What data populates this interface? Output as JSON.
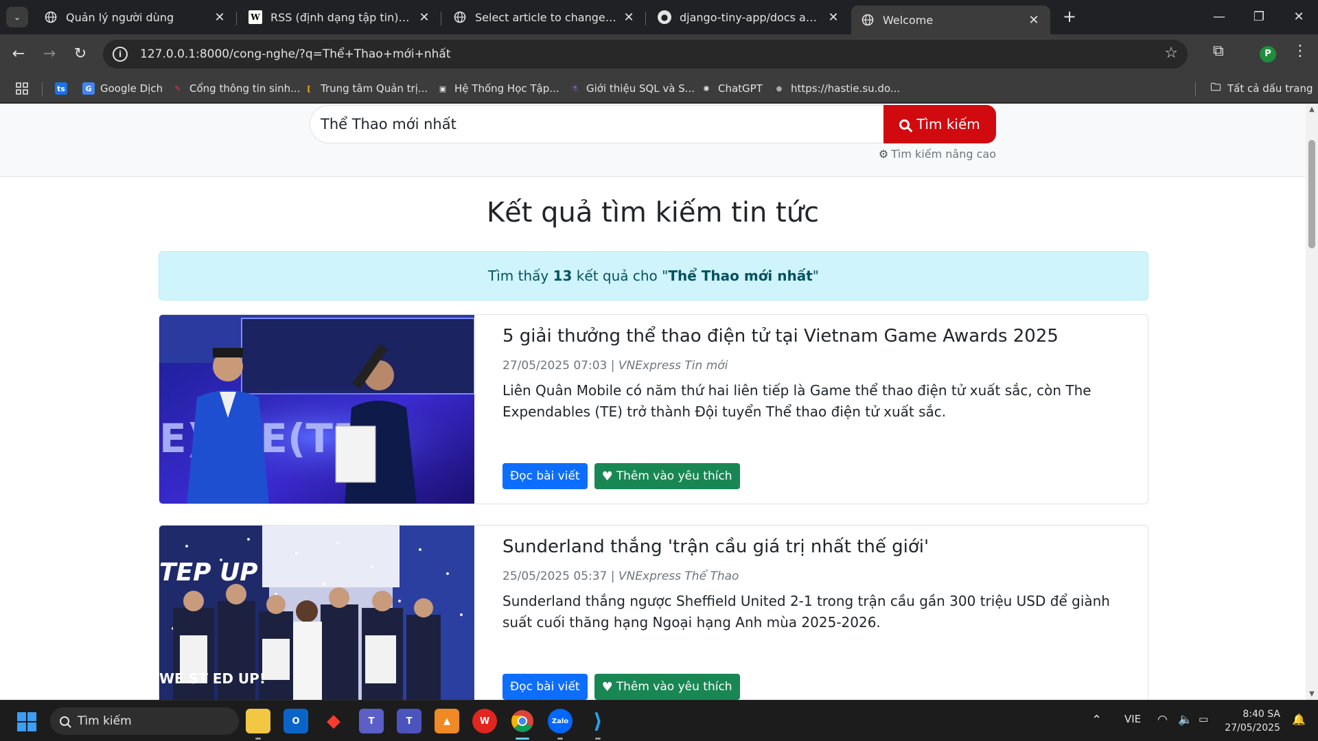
{
  "browser": {
    "tabs": [
      {
        "title": "Quản lý người dùng",
        "favicon": "globe-icon"
      },
      {
        "title": "RSS (định dạng tập tin) – Wikipedia",
        "favicon": "wikipedia-icon"
      },
      {
        "title": "Select article to change | news admin",
        "favicon": "globe-icon"
      },
      {
        "title": "django-tiny-app/docs at main · GitHub",
        "favicon": "github-icon"
      },
      {
        "title": "Welcome",
        "favicon": "globe-icon"
      }
    ],
    "active_tab": 4,
    "url": "127.0.0.1:8000/cong-nghe/?q=Thể+Thao+mới+nhất",
    "profile_initial": "P"
  },
  "bookmarks": {
    "items": [
      {
        "label": "",
        "icon": "ts"
      },
      {
        "label": "Google Dịch",
        "icon": "G"
      },
      {
        "label": "Cổng thông tin sinh...",
        "icon": "✎"
      },
      {
        "label": "Trung tâm Quản trị...",
        "icon": "["
      },
      {
        "label": "Hệ Thống Học Tập...",
        "icon": "▣"
      },
      {
        "label": "Giới thiệu SQL và S...",
        "icon": "⚗"
      },
      {
        "label": "ChatGPT",
        "icon": "✺"
      },
      {
        "label": "https://hastie.su.do...",
        "icon": "⊕"
      }
    ],
    "all_bookmarks": "Tất cả dấu trang"
  },
  "search": {
    "query": "Thể Thao mới nhất",
    "button_label": "Tìm kiếm",
    "advanced_label": "Tìm kiếm nâng cao"
  },
  "results": {
    "heading": "Kết quả tìm kiếm tin tức",
    "summary_prefix": "Tìm thấy ",
    "count": "13",
    "summary_middle": " kết quả cho \"",
    "summary_query": "Thể Thao mới nhất",
    "summary_suffix": "\"",
    "articles": [
      {
        "title": "5 giải thưởng thể thao điện tử tại Vietnam Game Awards 2025",
        "date": "27/05/2025 07:03 | ",
        "source": "VNExpress Tin mới",
        "description": "Liên Quân Mobile có năm thứ hai liên tiếp là Game thể thao điện tử xuất sắc, còn The Expendables (TE) trở thành Đội tuyển Thể thao điện tử xuất sắc.",
        "read_label": "Đọc bài viết",
        "fav_label": "Thêm vào yêu thích",
        "image_text": "E)BLE(TE)"
      },
      {
        "title": "Sunderland thắng 'trận cầu giá trị nhất thế giới'",
        "date": "25/05/2025 05:37 | ",
        "source": "VNExpress Thể Thao",
        "description": "Sunderland thắng ngược Sheffield United 2-1 trong trận cầu gần 300 triệu USD để giành suất cuối thăng hạng Ngoại hạng Anh mùa 2025-2026.",
        "read_label": "Đọc bài viết",
        "fav_label": "Thêm vào yêu thích",
        "image_text_top": "TEP UP",
        "image_text_bottom": "WE ST ED UP!"
      }
    ]
  },
  "taskbar": {
    "search_label": "Tìm kiếm",
    "language": "VIE",
    "time": "8:40 SA",
    "date": "27/05/2025"
  },
  "colors": {
    "search_button": "#d10a10",
    "alert_bg": "#cff4fc",
    "btn_primary": "#0d6efd",
    "btn_success": "#198754"
  }
}
